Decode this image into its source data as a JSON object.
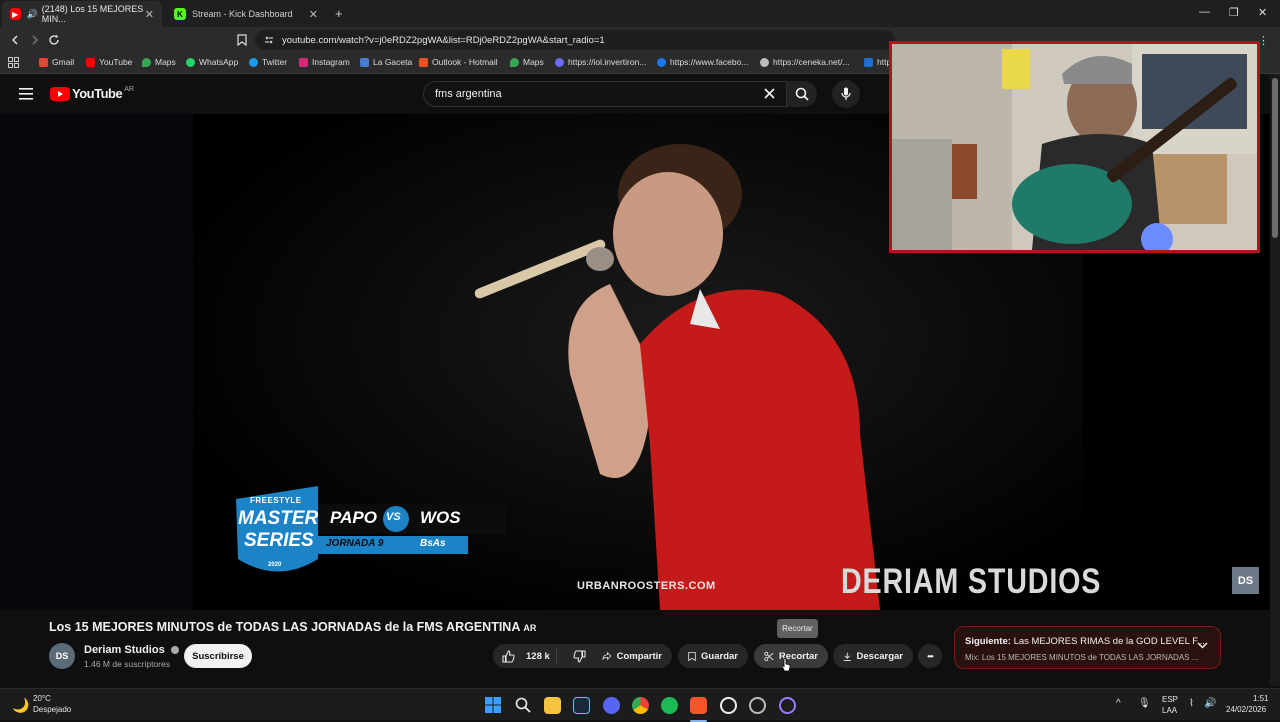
{
  "browser": {
    "tabs": [
      {
        "title": "(2148) Los 15 MEJORES MIN...",
        "active": true
      },
      {
        "title": "Stream - Kick Dashboard",
        "active": false
      }
    ],
    "new_tab": "+",
    "url": "youtube.com/watch?v=j0eRDZ2pgWA&list=RDj0eRDZ2pgWA&start_radio=1",
    "bookmarks": [
      {
        "label": "Gmail",
        "color": "#ea4335"
      },
      {
        "label": "YouTube",
        "color": "#ff0000"
      },
      {
        "label": "Maps",
        "color": "#34a853"
      },
      {
        "label": "WhatsApp",
        "color": "#25d366"
      },
      {
        "label": "Twitter",
        "color": "#1d9bf0"
      },
      {
        "label": "Instagram",
        "color": "#d62976"
      },
      {
        "label": "La Gaceta",
        "color": "#4a7bd0"
      },
      {
        "label": "Outlook - Hotmail",
        "color": "#f25022"
      },
      {
        "label": "Maps",
        "color": "#34a853"
      },
      {
        "label": "https://iol.invertiron...",
        "color": "#6b6bff"
      },
      {
        "label": "https://www.facebo...",
        "color": "#1877f2"
      },
      {
        "label": "https://ceneka.net/...",
        "color": "#bbbbbb"
      },
      {
        "label": "http",
        "color": "#1d6fd6"
      }
    ]
  },
  "youtube": {
    "logo_text": "YouTube",
    "country": "AR",
    "search_value": "fms argentina",
    "video": {
      "overlay_top_label": "FREESTYLE",
      "overlay_brand_1": "MASTER",
      "overlay_brand_2": "SERIES",
      "overlay_year": "2020",
      "player_1": "PAPO",
      "vs": "VS",
      "player_2": "WOS",
      "round": "JORNADA 9",
      "city": "BsAs",
      "watermark_url": "URBANROOSTERS.COM",
      "studio_watermark": "DERIAM STUDIOS",
      "corner_logo": "DS"
    },
    "title": "Los 15 MEJORES MINUTOS de TODAS LAS JORNADAS de la FMS ARGENTINA",
    "title_badge": "AR",
    "channel": {
      "avatar_text": "DS",
      "name": "Deriam Studios",
      "subscribers": "1.46 M de suscriptores",
      "subscribe_label": "Suscribirse"
    },
    "actions": {
      "likes": "128 k",
      "share": "Compartir",
      "save": "Guardar",
      "clip": "Recortar",
      "download": "Descargar",
      "more": "•••"
    },
    "tooltip": "Recortar",
    "up_next": {
      "prefix": "Siguiente:",
      "title": "Las MEJORES RIMAS de la GOD LEVEL F...",
      "mix": "Mix: Los 15 MEJORES MINUTOS de TODAS LAS JORNADAS ..."
    }
  },
  "taskbar": {
    "weather_temp": "20°C",
    "weather_desc": "Despejado",
    "lang_1": "ESP",
    "lang_2": "LAA",
    "time": "1:51",
    "date": "24/02/2026"
  }
}
